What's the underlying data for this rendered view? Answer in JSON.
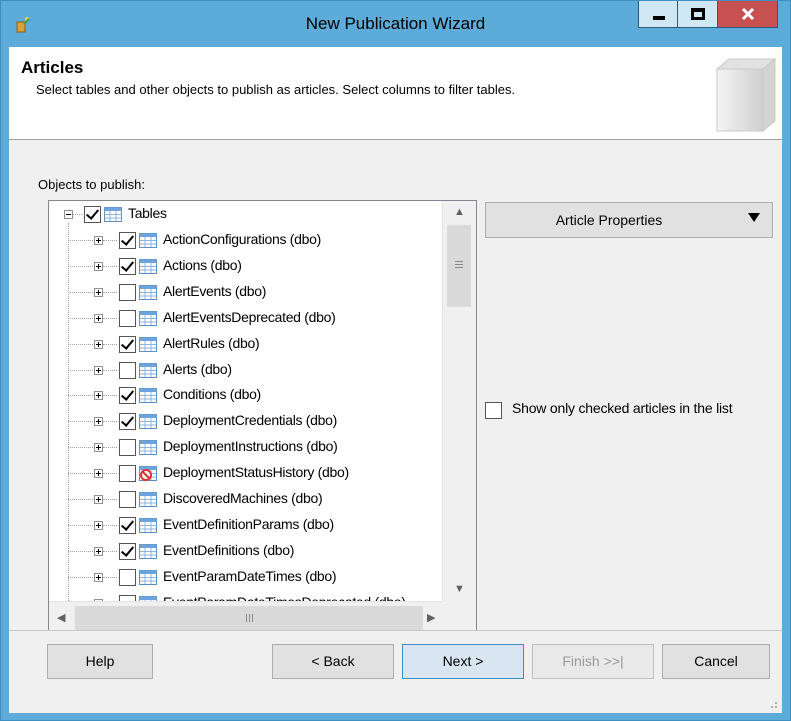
{
  "window": {
    "title": "New Publication Wizard"
  },
  "header": {
    "title": "Articles",
    "description": "Select tables and other objects to publish as articles. Select columns to filter tables."
  },
  "objects_label": "Objects to publish:",
  "tree": {
    "root": {
      "label": "Tables",
      "checked": true
    },
    "items": [
      {
        "label": "ActionConfigurations (dbo)",
        "checked": true,
        "icon": "table-icon"
      },
      {
        "label": "Actions (dbo)",
        "checked": true,
        "icon": "table-icon"
      },
      {
        "label": "AlertEvents (dbo)",
        "checked": false,
        "icon": "table-icon"
      },
      {
        "label": "AlertEventsDeprecated (dbo)",
        "checked": false,
        "icon": "table-icon"
      },
      {
        "label": "AlertRules (dbo)",
        "checked": true,
        "icon": "table-icon"
      },
      {
        "label": "Alerts (dbo)",
        "checked": false,
        "icon": "table-icon"
      },
      {
        "label": "Conditions (dbo)",
        "checked": true,
        "icon": "table-icon"
      },
      {
        "label": "DeploymentCredentials (dbo)",
        "checked": true,
        "icon": "table-icon"
      },
      {
        "label": "DeploymentInstructions (dbo)",
        "checked": false,
        "icon": "table-icon"
      },
      {
        "label": "DeploymentStatusHistory (dbo)",
        "checked": false,
        "icon": "table-blocked-icon"
      },
      {
        "label": "DiscoveredMachines (dbo)",
        "checked": false,
        "icon": "table-icon"
      },
      {
        "label": "EventDefinitionParams (dbo)",
        "checked": true,
        "icon": "table-icon"
      },
      {
        "label": "EventDefinitions (dbo)",
        "checked": true,
        "icon": "table-icon"
      },
      {
        "label": "EventParamDateTimes (dbo)",
        "checked": false,
        "icon": "table-icon"
      },
      {
        "label": "EventParamDateTimesDeprecated (dbo)",
        "checked": false,
        "icon": "table-icon"
      }
    ]
  },
  "article_properties": {
    "label": "Article Properties"
  },
  "show_only_checked": {
    "label": "Show only checked articles in the list",
    "checked": false
  },
  "buttons": {
    "help": "Help",
    "back": "< Back",
    "next": "Next >",
    "finish": "Finish >>|",
    "cancel": "Cancel"
  },
  "colors": {
    "titlebar": "#5cabd9",
    "close": "#c75050",
    "dialog_bg": "#f0f0f0"
  }
}
